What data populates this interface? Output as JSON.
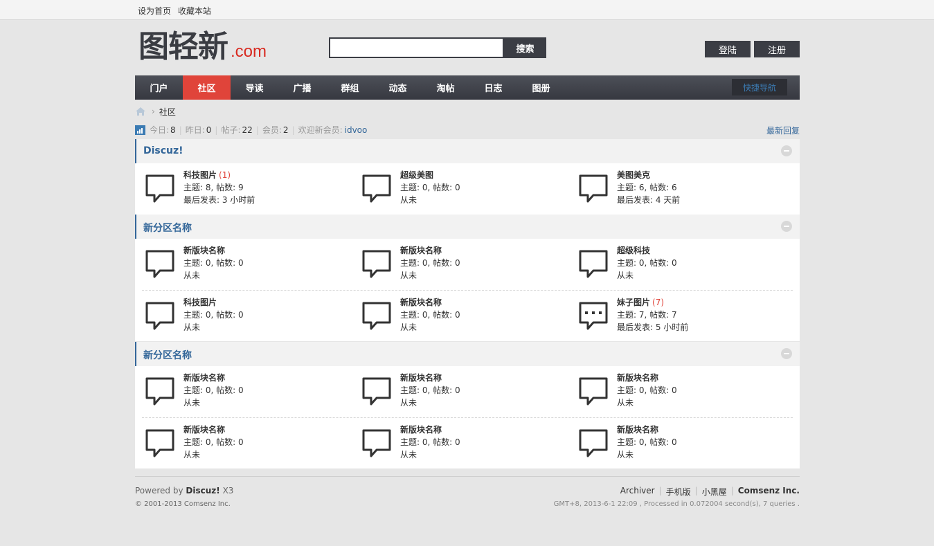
{
  "topbar": {
    "set_home": "设为首页",
    "bookmark": "收藏本站"
  },
  "logo": {
    "main": "图轻新",
    "suffix": ".com"
  },
  "search": {
    "value": "",
    "placeholder": "",
    "button": "搜索"
  },
  "auth": {
    "login": "登陆",
    "register": "注册"
  },
  "nav": {
    "items": [
      "门户",
      "社区",
      "导读",
      "广播",
      "群组",
      "动态",
      "淘帖",
      "日志",
      "图册"
    ],
    "active_index": 1,
    "quick_nav": "快捷导航"
  },
  "breadcrumb": {
    "current": "社区",
    "separator": "›"
  },
  "stats": {
    "today_label": "今日:",
    "today": "8",
    "yesterday_label": "昨日:",
    "yesterday": "0",
    "posts_label": "帖子:",
    "posts": "22",
    "members_label": "会员:",
    "members": "2",
    "welcome_label": "欢迎新会员:",
    "new_member": "idvoo",
    "latest_replies": "最新回复"
  },
  "categories": [
    {
      "title": "Discuz!",
      "rows": [
        [
          {
            "name": "科技图片",
            "new": "(1)",
            "line1": "主题: 8, 帖数: 9",
            "line2": "最后发表: 3 小时前",
            "icon": "speech-bubble-icon"
          },
          {
            "name": "超级美图",
            "new": "",
            "line1": "主题: 0, 帖数: 0",
            "line2": "从未",
            "icon": "speech-bubble-icon"
          },
          {
            "name": "美图美克",
            "new": "",
            "line1": "主题: 6, 帖数: 6",
            "line2": "最后发表: 4 天前",
            "icon": "speech-bubble-icon"
          }
        ]
      ]
    },
    {
      "title": "新分区名称",
      "rows": [
        [
          {
            "name": "新版块名称",
            "new": "",
            "line1": "主题: 0, 帖数: 0",
            "line2": "从未",
            "icon": "speech-bubble-icon"
          },
          {
            "name": "新版块名称",
            "new": "",
            "line1": "主题: 0, 帖数: 0",
            "line2": "从未",
            "icon": "speech-bubble-icon"
          },
          {
            "name": "超级科技",
            "new": "",
            "line1": "主题: 0, 帖数: 0",
            "line2": "从未",
            "icon": "speech-bubble-icon"
          }
        ],
        [
          {
            "name": "科技图片",
            "new": "",
            "line1": "主题: 0, 帖数: 0",
            "line2": "从未",
            "icon": "speech-bubble-icon"
          },
          {
            "name": "新版块名称",
            "new": "",
            "line1": "主题: 0, 帖数: 0",
            "line2": "从未",
            "icon": "speech-bubble-icon"
          },
          {
            "name": "妹子图片",
            "new": "(7)",
            "line1": "主题: 7, 帖数: 7",
            "line2": "最后发表: 5 小时前",
            "icon": "speech-bubble-dots-icon"
          }
        ]
      ]
    },
    {
      "title": "新分区名称",
      "rows": [
        [
          {
            "name": "新版块名称",
            "new": "",
            "line1": "主题: 0, 帖数: 0",
            "line2": "从未",
            "icon": "speech-bubble-icon"
          },
          {
            "name": "新版块名称",
            "new": "",
            "line1": "主题: 0, 帖数: 0",
            "line2": "从未",
            "icon": "speech-bubble-icon"
          },
          {
            "name": "新版块名称",
            "new": "",
            "line1": "主题: 0, 帖数: 0",
            "line2": "从未",
            "icon": "speech-bubble-icon"
          }
        ],
        [
          {
            "name": "新版块名称",
            "new": "",
            "line1": "主题: 0, 帖数: 0",
            "line2": "从未",
            "icon": "speech-bubble-icon"
          },
          {
            "name": "新版块名称",
            "new": "",
            "line1": "主题: 0, 帖数: 0",
            "line2": "从未",
            "icon": "speech-bubble-icon"
          },
          {
            "name": "新版块名称",
            "new": "",
            "line1": "主题: 0, 帖数: 0",
            "line2": "从未",
            "icon": "speech-bubble-icon"
          }
        ]
      ]
    }
  ],
  "footer": {
    "powered_by": "Powered by",
    "product": "Discuz!",
    "version": "X3",
    "copyright": "© 2001-2013 Comsenz Inc.",
    "links": [
      "Archiver",
      "手机版",
      "小黑屋"
    ],
    "company": "Comsenz Inc.",
    "run_info": "GMT+8, 2013-6-1 22:09 , Processed in 0.072004 second(s), 7 queries ."
  },
  "colors": {
    "accent": "#336699",
    "active_nav": "#e0443a",
    "dark": "#3b3d44",
    "new_count": "#e0443a"
  }
}
